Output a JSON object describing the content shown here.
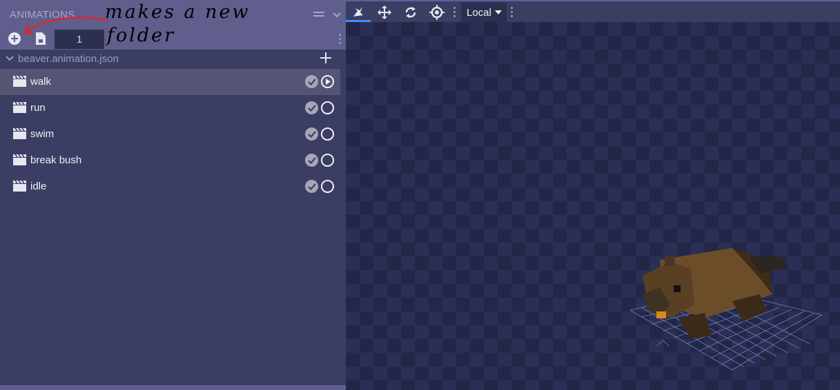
{
  "panel": {
    "title": "ANIMATIONS",
    "frame_value": "1"
  },
  "file": {
    "name": "beaver.animation.json"
  },
  "animations": [
    {
      "label": "walk",
      "selected": true
    },
    {
      "label": "run",
      "selected": false
    },
    {
      "label": "swim",
      "selected": false
    },
    {
      "label": "break bush",
      "selected": false
    },
    {
      "label": "idle",
      "selected": false
    }
  ],
  "viewport": {
    "transform_space": "Local"
  },
  "annotation": {
    "line1": "makes a new",
    "line2": "folder",
    "arrow_color": "#e0252b"
  },
  "icons": {
    "add_folder": "plus-circle-icon",
    "new_file": "file-icon",
    "move": "move-icon",
    "rotate": "rotate-icon",
    "pivot": "crosshair-icon"
  },
  "colors": {
    "accent": "#3e90ff",
    "panel_header": "#5f5e8d",
    "panel": "#3b3d63"
  }
}
